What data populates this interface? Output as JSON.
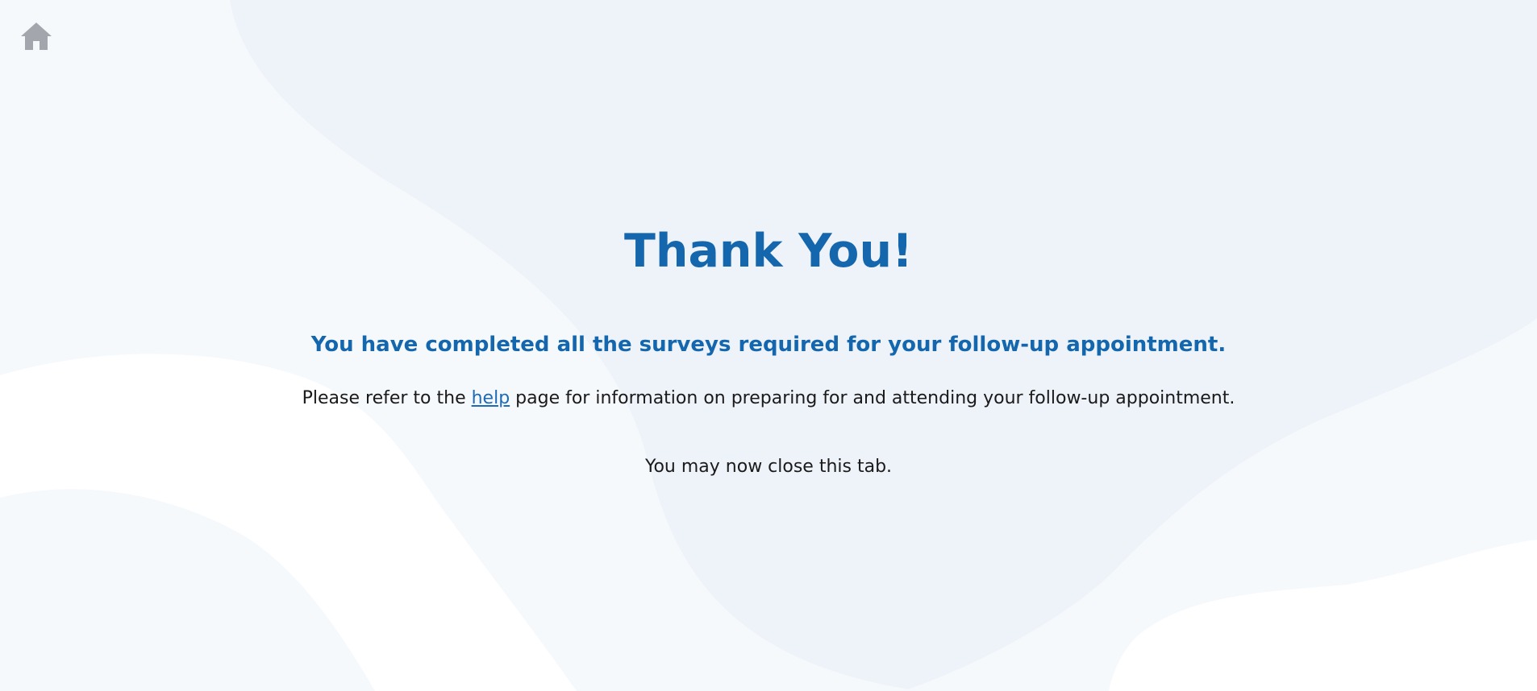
{
  "nav": {
    "home_icon": "home-icon"
  },
  "main": {
    "title": "Thank You!",
    "subtitle": "You have completed all the surveys required for your follow-up appointment.",
    "info_before": "Please refer to the ",
    "info_link": "help",
    "info_after": " page for information on preparing for and attending your follow-up appointment.",
    "close_note": "You may now close this tab."
  },
  "colors": {
    "heading": "#1466ad",
    "link": "#1d6bb6",
    "body_text": "#1a1a1a",
    "icon": "#a3a6ad",
    "background_wave": "#eef3fa",
    "background_light": "#f6f9fc"
  }
}
